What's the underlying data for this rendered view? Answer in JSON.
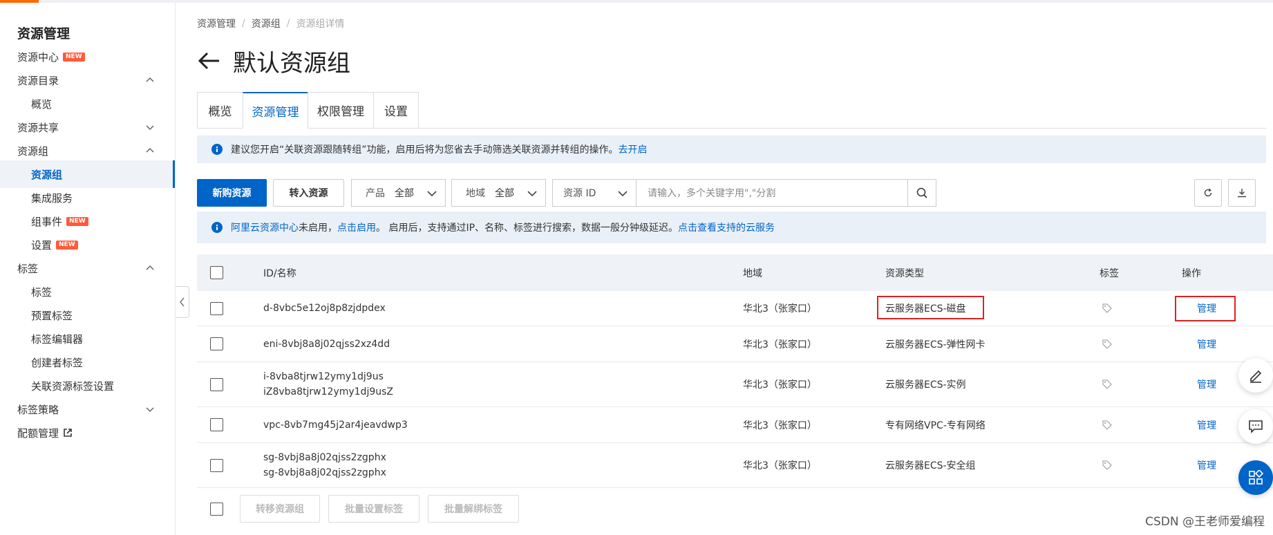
{
  "sidebar": {
    "title": "资源管理",
    "items": [
      {
        "label": "资源中心",
        "badge": "NEW"
      },
      {
        "label": "资源目录"
      },
      {
        "label": "概览"
      },
      {
        "label": "资源共享"
      },
      {
        "label": "资源组"
      },
      {
        "label": "资源组"
      },
      {
        "label": "集成服务"
      },
      {
        "label": "组事件",
        "badge": "NEW"
      },
      {
        "label": "设置",
        "badge": "NEW"
      },
      {
        "label": "标签"
      },
      {
        "label": "标签"
      },
      {
        "label": "预置标签"
      },
      {
        "label": "标签编辑器"
      },
      {
        "label": "创建者标签"
      },
      {
        "label": "关联资源标签设置"
      },
      {
        "label": "标签策略"
      },
      {
        "label": "配额管理"
      }
    ]
  },
  "breadcrumb": [
    "资源管理",
    "资源组",
    "资源组详情"
  ],
  "page_title": "默认资源组",
  "tabs": [
    "概览",
    "资源管理",
    "权限管理",
    "设置"
  ],
  "notice1": {
    "text": "建议您开启“关联资源跟随转组”功能，启用后将为您省去手动筛选关联资源并转组的操作。",
    "link": "去开启"
  },
  "toolbar": {
    "buy_button": "新购资源",
    "transfer_button": "转入资源",
    "product_filter": {
      "label": "产品",
      "value": "全部"
    },
    "region_filter": {
      "label": "地域",
      "value": "全部"
    },
    "search_key": "资源 ID",
    "search_placeholder": "请输入，多个关键字用\",\"分割"
  },
  "notice2": {
    "link1": "阿里云资源中心",
    "text1": "未启用，",
    "link2": "点击启用",
    "text2": "。 启用后，支持通过IP、名称、标签进行搜索，数据一般分钟级延迟。",
    "link3": "点击查看支持的云服务"
  },
  "table": {
    "headers": {
      "name": "ID/名称",
      "region": "地域",
      "type": "资源类型",
      "tag": "标签",
      "action": "操作"
    },
    "rows": [
      {
        "id": "d-8vbc5e12oj8p8zjdpdex",
        "name": "",
        "region": "华北3（张家口）",
        "type": "云服务器ECS-磁盘",
        "action": "管理"
      },
      {
        "id": "eni-8vbj8a8j02qjss2xz4dd",
        "name": "",
        "region": "华北3（张家口）",
        "type": "云服务器ECS-弹性网卡",
        "action": "管理"
      },
      {
        "id": "i-8vba8tjrw12ymy1dj9us",
        "name": "iZ8vba8tjrw12ymy1dj9usZ",
        "region": "华北3（张家口）",
        "type": "云服务器ECS-实例",
        "action": "管理"
      },
      {
        "id": "vpc-8vb7mg45j2ar4jeavdwp3",
        "name": "",
        "region": "华北3（张家口）",
        "type": "专有网络VPC-专有网络",
        "action": "管理"
      },
      {
        "id": "sg-8vbj8a8j02qjss2zgphx",
        "name": "sg-8vbj8a8j02qjss2zgphx",
        "region": "华北3（张家口）",
        "type": "云服务器ECS-安全组",
        "action": "管理"
      }
    ]
  },
  "bulk_actions": [
    "转移资源组",
    "批量设置标签",
    "批量解绑标签"
  ],
  "watermark": "CSDN @王老师爱编程",
  "colors": {
    "accent": "#0064c8",
    "orange": "#ff6a00",
    "highlight": "#e02020"
  }
}
